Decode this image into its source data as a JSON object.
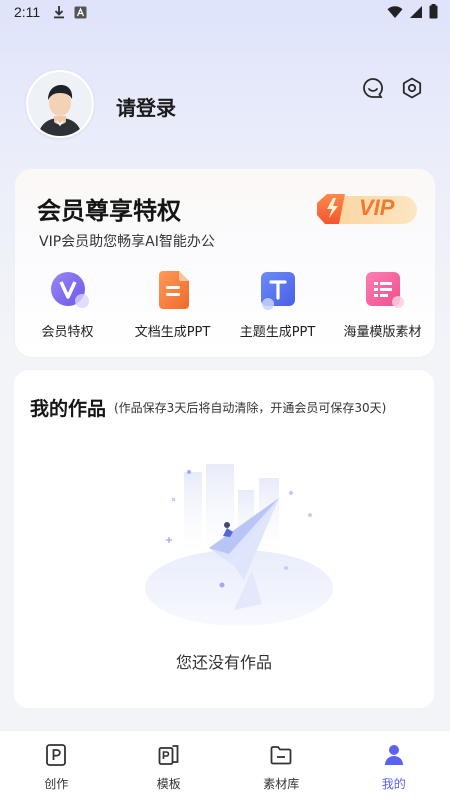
{
  "status_bar": {
    "time": "2:11"
  },
  "profile": {
    "login_label": "请登录"
  },
  "vip": {
    "title": "会员尊享特权",
    "subtitle": "VIP会员助您畅享AI智能办公",
    "badge_text": "VIP",
    "features": [
      {
        "label": "会员特权",
        "icon": "vip-v-icon"
      },
      {
        "label": "文档生成PPT",
        "icon": "document-icon"
      },
      {
        "label": "主题生成PPT",
        "icon": "theme-t-icon"
      },
      {
        "label": "海量模版素材",
        "icon": "template-list-icon"
      }
    ]
  },
  "works": {
    "title": "我的作品",
    "note": "(作品保存3天后将自动清除，开通会员可保存30天)",
    "empty_text": "您还没有作品"
  },
  "nav": {
    "items": [
      {
        "label": "创作",
        "icon": "create-p-icon"
      },
      {
        "label": "模板",
        "icon": "template-icon"
      },
      {
        "label": "素材库",
        "icon": "folder-icon"
      },
      {
        "label": "我的",
        "icon": "user-icon"
      }
    ],
    "active_index": 3
  },
  "colors": {
    "accent": "#5b61f0",
    "vip_orange": "#f7a24b",
    "text_dark": "#151515"
  }
}
